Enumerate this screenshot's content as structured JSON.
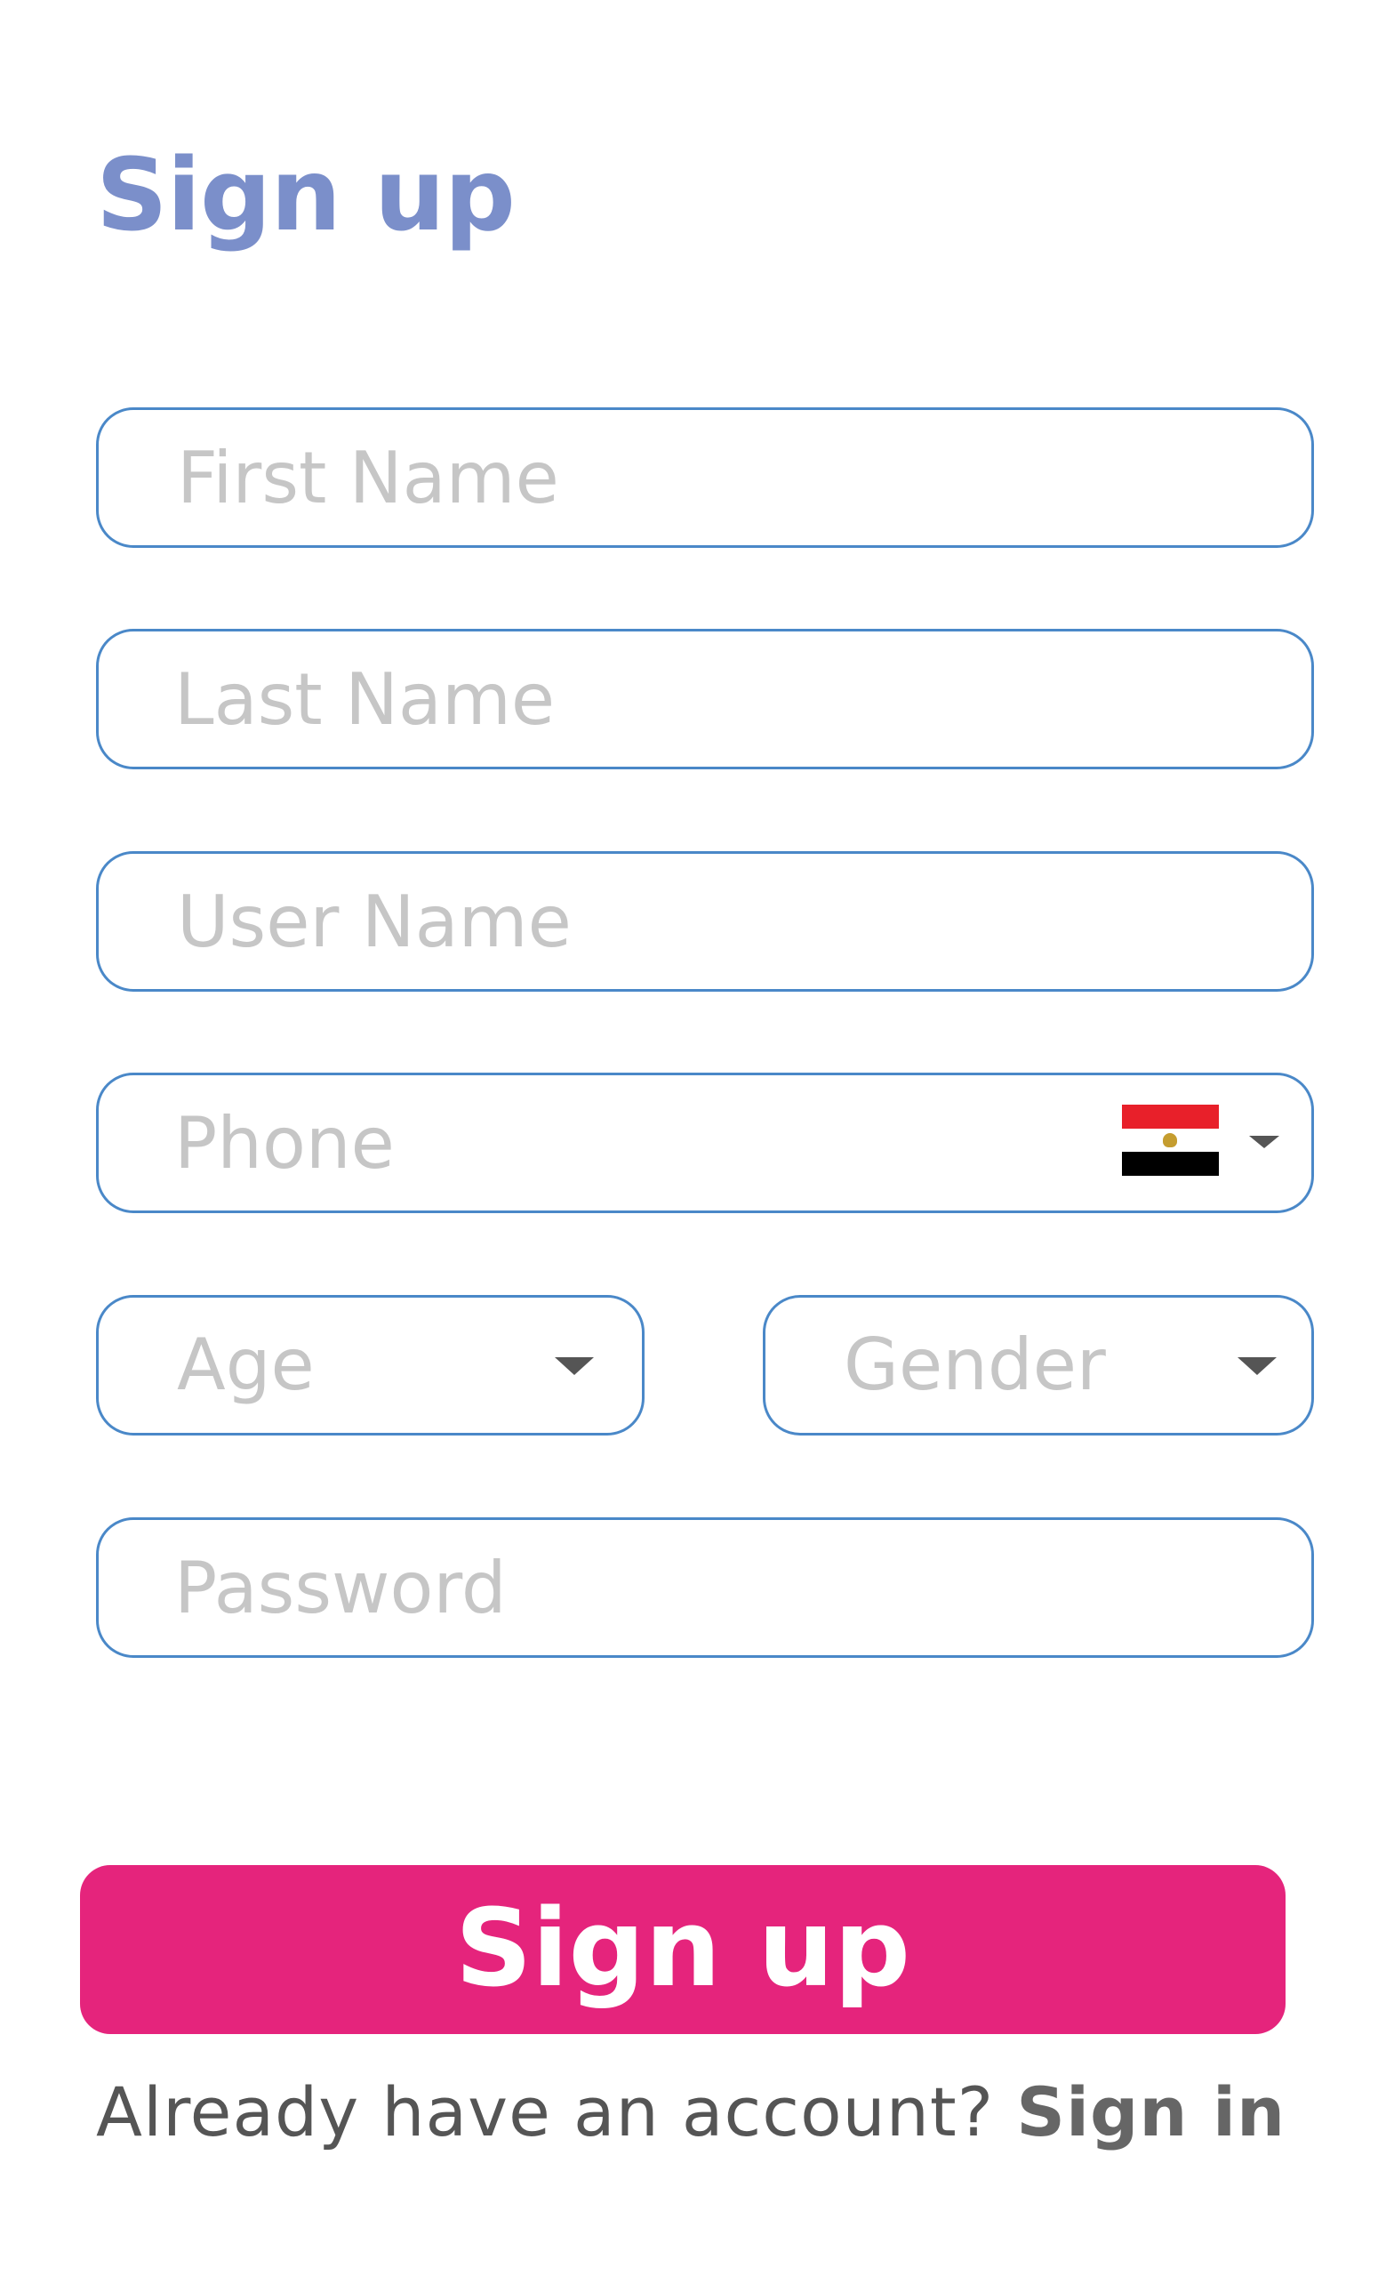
{
  "header": {
    "title": "Sign up"
  },
  "form": {
    "first_name": {
      "placeholder": "First Name",
      "value": ""
    },
    "last_name": {
      "placeholder": "Last Name",
      "value": ""
    },
    "user_name": {
      "placeholder": "User Name",
      "value": ""
    },
    "phone": {
      "placeholder": "Phone",
      "value": "",
      "country_flag": "egypt-flag-icon"
    },
    "age": {
      "placeholder": "Age",
      "icon": "caret-down-icon"
    },
    "gender": {
      "placeholder": "Gender",
      "icon": "caret-down-icon"
    },
    "password": {
      "placeholder": "Password",
      "value": ""
    }
  },
  "actions": {
    "submit_label": "Sign up"
  },
  "footer": {
    "prompt": "Already have an account? ",
    "link_label": "Sign in"
  },
  "colors": {
    "title": "#7b8fca",
    "field_border": "#4a88c8",
    "placeholder": "#c6c6c6",
    "button_bg": "#e5247c",
    "button_text": "#ffffff",
    "footer_text": "#555555"
  }
}
